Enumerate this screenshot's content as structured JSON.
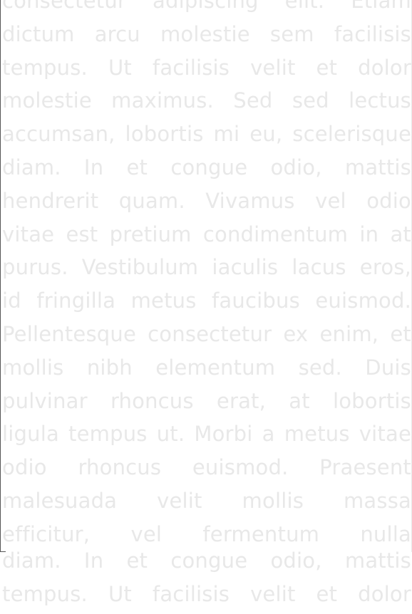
{
  "document": {
    "lines": [
      "consectetur adipiscing elit. Etiam",
      "dictum arcu molestie sem facilisis",
      "tempus. Ut facilisis velit et dolor",
      "molestie maximus. Sed sed lectus",
      "accumsan, lobortis mi eu, scelerisque",
      "diam. In et congue odio, mattis",
      "hendrerit quam. Vivamus vel odio",
      "vitae est pretium condimentum in at",
      "purus. Vestibulum iaculis lacus eros,",
      "id fringilla metus faucibus euismod.",
      "Pellentesque consectetur ex enim, et",
      "mollis nibh elementum sed. Duis",
      "pulvinar rhoncus erat, at lobortis",
      "ligula tempus ut. Morbi a metus vitae",
      "odio rhoncus euismod. Praesent",
      "malesuada velit mollis massa",
      "efficitur, vel fermentum nulla"
    ],
    "spill_lines": [
      "diam. In et congue odio, mattis",
      "tempus. Ut facilisis velit et dolor"
    ]
  },
  "colors": {
    "text": "#e8e8e8",
    "background": "#ffffff",
    "frame": "#555555"
  }
}
